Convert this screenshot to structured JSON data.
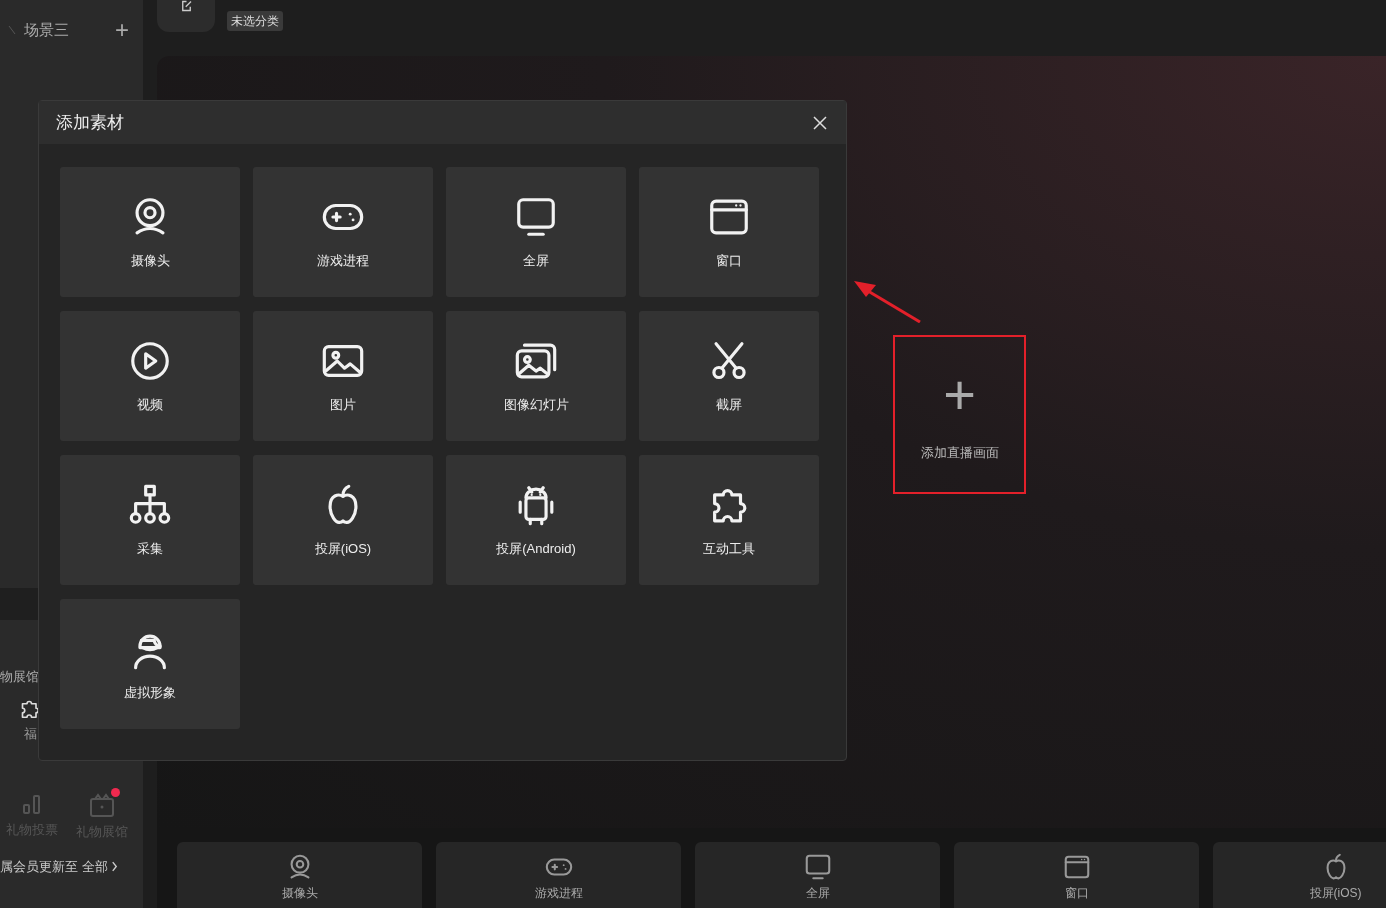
{
  "scene": {
    "label": "场景三",
    "add": "+"
  },
  "category_tag": "未选分类",
  "sidebar": {
    "section_label": "物展馆",
    "items": [
      {
        "label": "福",
        "badge": false
      },
      {
        "label": "礼物投票",
        "badge": false
      },
      {
        "label": "礼物展馆",
        "badge": true
      }
    ],
    "footer_text": "属会员更新至",
    "footer_link": "全部"
  },
  "dialog": {
    "title": "添加素材",
    "tiles": [
      {
        "label": "摄像头"
      },
      {
        "label": "游戏进程"
      },
      {
        "label": "全屏"
      },
      {
        "label": "窗口"
      },
      {
        "label": "视频"
      },
      {
        "label": "图片"
      },
      {
        "label": "图像幻灯片"
      },
      {
        "label": "截屏"
      },
      {
        "label": "采集"
      },
      {
        "label": "投屏(iOS)"
      },
      {
        "label": "投屏(Android)"
      },
      {
        "label": "互动工具"
      },
      {
        "label": "虚拟形象"
      }
    ]
  },
  "preview": {
    "add_label": "添加直播画面",
    "add_icon": "+"
  },
  "bottom_bar": [
    {
      "label": "摄像头"
    },
    {
      "label": "游戏进程"
    },
    {
      "label": "全屏"
    },
    {
      "label": "窗口"
    },
    {
      "label": "投屏(iOS)"
    }
  ]
}
